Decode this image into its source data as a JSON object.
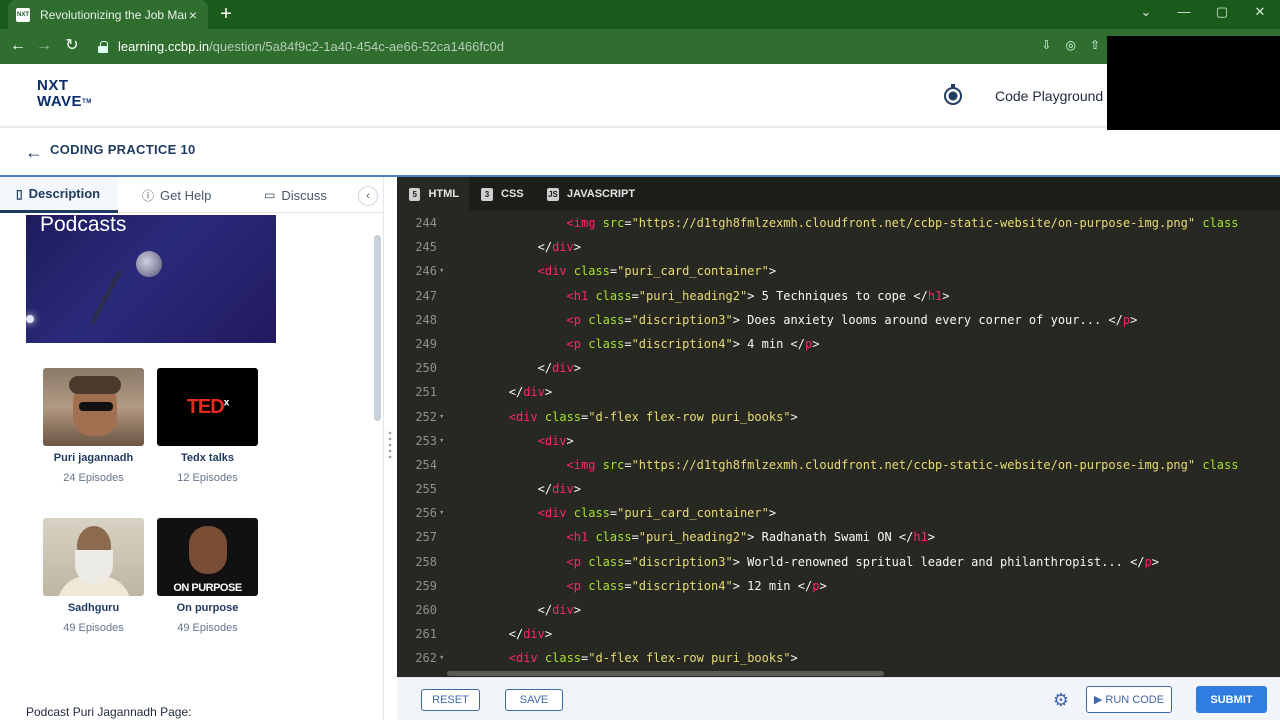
{
  "browser": {
    "tab_title": "Revolutionizing the Job Market |",
    "favicon_text": "NXT",
    "url_host": "learning.ccbp.in",
    "url_path": "/question/5a84f9c2-1a40-454c-ae66-52ca1466fc0d"
  },
  "site": {
    "logo_line1": "NXT",
    "logo_line2": "WAVE",
    "playground_label": "Code Playground"
  },
  "practice": {
    "title": "CODING PRACTICE 10"
  },
  "left_tabs": {
    "description": "Description",
    "help": "Get Help",
    "discuss": "Discuss"
  },
  "preview": {
    "hero_title": "Podcasts",
    "podcasts": [
      {
        "name": "Puri jagannadh",
        "episodes": "24 Episodes"
      },
      {
        "name": "Tedx talks",
        "episodes": "12 Episodes"
      },
      {
        "name": "Sadhguru",
        "episodes": "49 Episodes"
      },
      {
        "name": "On purpose",
        "episodes": "49 Episodes"
      }
    ],
    "ted_logo": "TED",
    "ted_x": "x",
    "onpurpose_logo": "ON PURPOSE",
    "note": "Podcast Puri Jagannadh Page:"
  },
  "editor": {
    "tabs": [
      "HTML",
      "CSS",
      "JAVASCRIPT"
    ],
    "lines": [
      {
        "n": "244",
        "fold": "",
        "indent": 8,
        "tokens": [
          [
            "t",
            "<img"
          ],
          [
            "p",
            " "
          ],
          [
            "a",
            "src"
          ],
          [
            "p",
            "="
          ],
          [
            "s",
            "\"https://d1tgh8fmlzexmh.cloudfront.net/ccbp-static-website/on-purpose-img.png\""
          ],
          [
            "p",
            " "
          ],
          [
            "a",
            "class"
          ]
        ]
      },
      {
        "n": "245",
        "fold": "",
        "indent": 6,
        "tokens": [
          [
            "p",
            "</"
          ],
          [
            "t",
            "div"
          ],
          [
            "p",
            ">"
          ]
        ]
      },
      {
        "n": "246",
        "fold": "▾",
        "indent": 6,
        "tokens": [
          [
            "t",
            "<div"
          ],
          [
            "p",
            " "
          ],
          [
            "a",
            "class"
          ],
          [
            "p",
            "="
          ],
          [
            "s",
            "\"puri_card_container\""
          ],
          [
            "p",
            ">"
          ]
        ]
      },
      {
        "n": "247",
        "fold": "",
        "indent": 8,
        "tokens": [
          [
            "t",
            "<h1"
          ],
          [
            "p",
            " "
          ],
          [
            "a",
            "class"
          ],
          [
            "p",
            "="
          ],
          [
            "s",
            "\"puri_heading2\""
          ],
          [
            "p",
            "> 5 Techniques to cope </"
          ],
          [
            "t",
            "h1"
          ],
          [
            "p",
            ">"
          ]
        ]
      },
      {
        "n": "248",
        "fold": "",
        "indent": 8,
        "tokens": [
          [
            "t",
            "<p"
          ],
          [
            "p",
            " "
          ],
          [
            "a",
            "class"
          ],
          [
            "p",
            "="
          ],
          [
            "s",
            "\"discription3\""
          ],
          [
            "p",
            "> Does anxiety looms around every corner of your... </"
          ],
          [
            "t",
            "p"
          ],
          [
            "p",
            ">"
          ]
        ]
      },
      {
        "n": "249",
        "fold": "",
        "indent": 8,
        "tokens": [
          [
            "t",
            "<p"
          ],
          [
            "p",
            " "
          ],
          [
            "a",
            "class"
          ],
          [
            "p",
            "="
          ],
          [
            "s",
            "\"discription4\""
          ],
          [
            "p",
            "> 4 min </"
          ],
          [
            "t",
            "p"
          ],
          [
            "p",
            ">"
          ]
        ]
      },
      {
        "n": "250",
        "fold": "",
        "indent": 6,
        "tokens": [
          [
            "p",
            "</"
          ],
          [
            "t",
            "div"
          ],
          [
            "p",
            ">"
          ]
        ]
      },
      {
        "n": "251",
        "fold": "",
        "indent": 4,
        "tokens": [
          [
            "p",
            "</"
          ],
          [
            "t",
            "div"
          ],
          [
            "p",
            ">"
          ]
        ]
      },
      {
        "n": "252",
        "fold": "▾",
        "indent": 4,
        "tokens": [
          [
            "t",
            "<div"
          ],
          [
            "p",
            " "
          ],
          [
            "a",
            "class"
          ],
          [
            "p",
            "="
          ],
          [
            "s",
            "\"d-flex flex-row puri_books\""
          ],
          [
            "p",
            ">"
          ]
        ]
      },
      {
        "n": "253",
        "fold": "▾",
        "indent": 6,
        "tokens": [
          [
            "t",
            "<div"
          ],
          [
            "p",
            ">"
          ]
        ]
      },
      {
        "n": "254",
        "fold": "",
        "indent": 8,
        "tokens": [
          [
            "t",
            "<img"
          ],
          [
            "p",
            " "
          ],
          [
            "a",
            "src"
          ],
          [
            "p",
            "="
          ],
          [
            "s",
            "\"https://d1tgh8fmlzexmh.cloudfront.net/ccbp-static-website/on-purpose-img.png\""
          ],
          [
            "p",
            " "
          ],
          [
            "a",
            "class"
          ]
        ]
      },
      {
        "n": "255",
        "fold": "",
        "indent": 6,
        "tokens": [
          [
            "p",
            "</"
          ],
          [
            "t",
            "div"
          ],
          [
            "p",
            ">"
          ]
        ]
      },
      {
        "n": "256",
        "fold": "▾",
        "indent": 6,
        "tokens": [
          [
            "t",
            "<div"
          ],
          [
            "p",
            " "
          ],
          [
            "a",
            "class"
          ],
          [
            "p",
            "="
          ],
          [
            "s",
            "\"puri_card_container\""
          ],
          [
            "p",
            ">"
          ]
        ]
      },
      {
        "n": "257",
        "fold": "",
        "indent": 8,
        "tokens": [
          [
            "t",
            "<h1"
          ],
          [
            "p",
            " "
          ],
          [
            "a",
            "class"
          ],
          [
            "p",
            "="
          ],
          [
            "s",
            "\"puri_heading2\""
          ],
          [
            "p",
            "> Radhanath Swami ON </"
          ],
          [
            "t",
            "h1"
          ],
          [
            "p",
            ">"
          ]
        ]
      },
      {
        "n": "258",
        "fold": "",
        "indent": 8,
        "tokens": [
          [
            "t",
            "<p"
          ],
          [
            "p",
            " "
          ],
          [
            "a",
            "class"
          ],
          [
            "p",
            "="
          ],
          [
            "s",
            "\"discription3\""
          ],
          [
            "p",
            "> World-renowned spritual leader and philanthropist... </"
          ],
          [
            "t",
            "p"
          ],
          [
            "p",
            ">"
          ]
        ]
      },
      {
        "n": "259",
        "fold": "",
        "indent": 8,
        "tokens": [
          [
            "t",
            "<p"
          ],
          [
            "p",
            " "
          ],
          [
            "a",
            "class"
          ],
          [
            "p",
            "="
          ],
          [
            "s",
            "\"discription4\""
          ],
          [
            "p",
            "> 12 min </"
          ],
          [
            "t",
            "p"
          ],
          [
            "p",
            ">"
          ]
        ]
      },
      {
        "n": "260",
        "fold": "",
        "indent": 6,
        "tokens": [
          [
            "p",
            "</"
          ],
          [
            "t",
            "div"
          ],
          [
            "p",
            ">"
          ]
        ]
      },
      {
        "n": "261",
        "fold": "",
        "indent": 4,
        "tokens": [
          [
            "p",
            "</"
          ],
          [
            "t",
            "div"
          ],
          [
            "p",
            ">"
          ]
        ]
      },
      {
        "n": "262",
        "fold": "▾",
        "indent": 4,
        "tokens": [
          [
            "t",
            "<div"
          ],
          [
            "p",
            " "
          ],
          [
            "a",
            "class"
          ],
          [
            "p",
            "="
          ],
          [
            "s",
            "\"d-flex flex-row puri_books\""
          ],
          [
            "p",
            ">"
          ]
        ]
      }
    ]
  },
  "actions": {
    "reset": "RESET",
    "save": "SAVE",
    "run": "▶ RUN CODE",
    "submit": "SUBMIT"
  },
  "colors": {
    "accent": "#2f7de1",
    "editor_bg": "#272822",
    "browser_green": "#1a5b1c"
  }
}
